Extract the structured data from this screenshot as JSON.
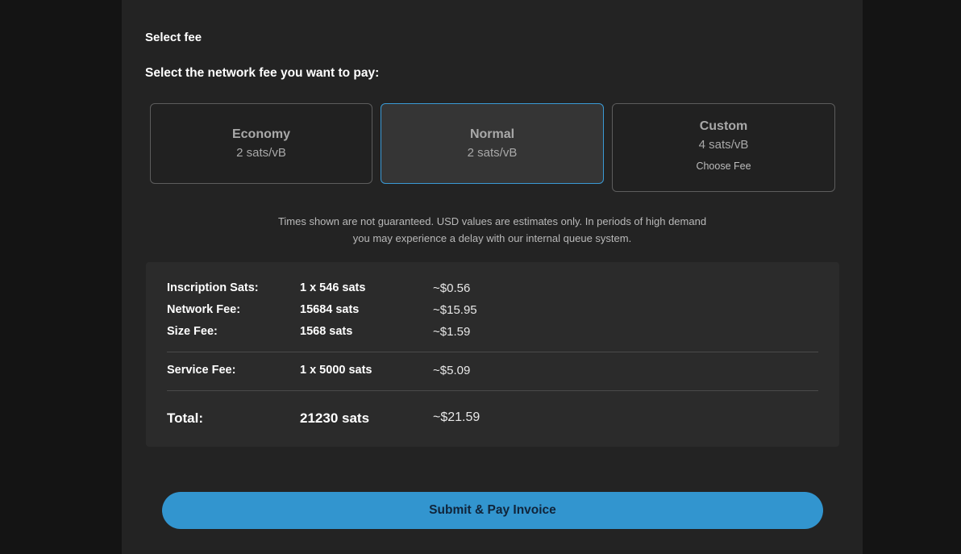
{
  "section_title": "Select fee",
  "fee_prompt": "Select the network fee you want to pay:",
  "fee_options": [
    {
      "name": "Economy",
      "rate": "2 sats/vB",
      "selected": false
    },
    {
      "name": "Normal",
      "rate": "2 sats/vB",
      "selected": true
    },
    {
      "name": "Custom",
      "rate": "4 sats/vB",
      "action": "Choose Fee",
      "selected": false
    }
  ],
  "disclaimer": "Times shown are not guaranteed. USD values are estimates only. In periods of high demand you may experience a delay with our internal queue system.",
  "summary": {
    "rows": [
      {
        "label": "Inscription Sats:",
        "sats": "1 x 546 sats",
        "usd": "~$0.56"
      },
      {
        "label": "Network Fee:",
        "sats": "15684 sats",
        "usd": "~$15.95"
      },
      {
        "label": "Size Fee:",
        "sats": "1568 sats",
        "usd": "~$1.59"
      },
      {
        "label": "Service Fee:",
        "sats": "1 x 5000 sats",
        "usd": "~$5.09"
      }
    ],
    "total": {
      "label": "Total:",
      "sats": "21230 sats",
      "usd": "~$21.59"
    }
  },
  "submit_label": "Submit & Pay Invoice",
  "colors": {
    "accent": "#3295cf",
    "selected_border": "#3a9ad5",
    "panel": "#232323",
    "background": "#141414"
  }
}
